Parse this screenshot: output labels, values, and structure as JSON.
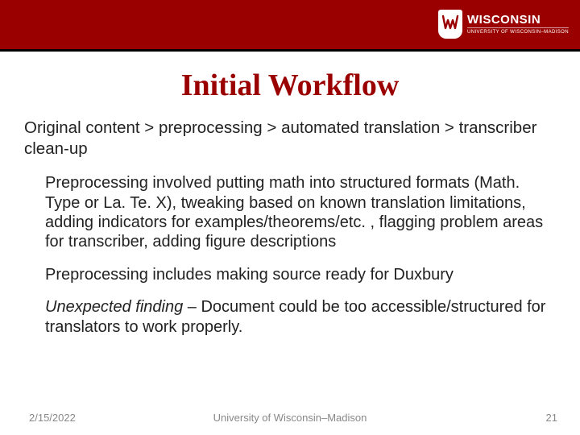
{
  "brand": {
    "name": "WISCONSIN",
    "subline": "UNIVERSITY OF WISCONSIN–MADISON",
    "crest_letter": "W"
  },
  "title": "Initial Workflow",
  "pipeline": "Original content > preprocessing > automated translation > transcriber clean-up",
  "paragraphs": {
    "p1": "Preprocessing involved putting math into structured formats (Math. Type or La. Te. X), tweaking based on known translation limitations, adding indicators for examples/theorems/etc. , flagging problem areas for transcriber, adding figure descriptions",
    "p2": "Preprocessing includes making source ready for Duxbury",
    "p3_lead": "Unexpected finding",
    "p3_rest": " – Document could be too accessible/structured for translators to work properly."
  },
  "footer": {
    "date": "2/15/2022",
    "org": "University of Wisconsin–Madison",
    "page": "21"
  },
  "colors": {
    "brand_red": "#9b0000"
  }
}
